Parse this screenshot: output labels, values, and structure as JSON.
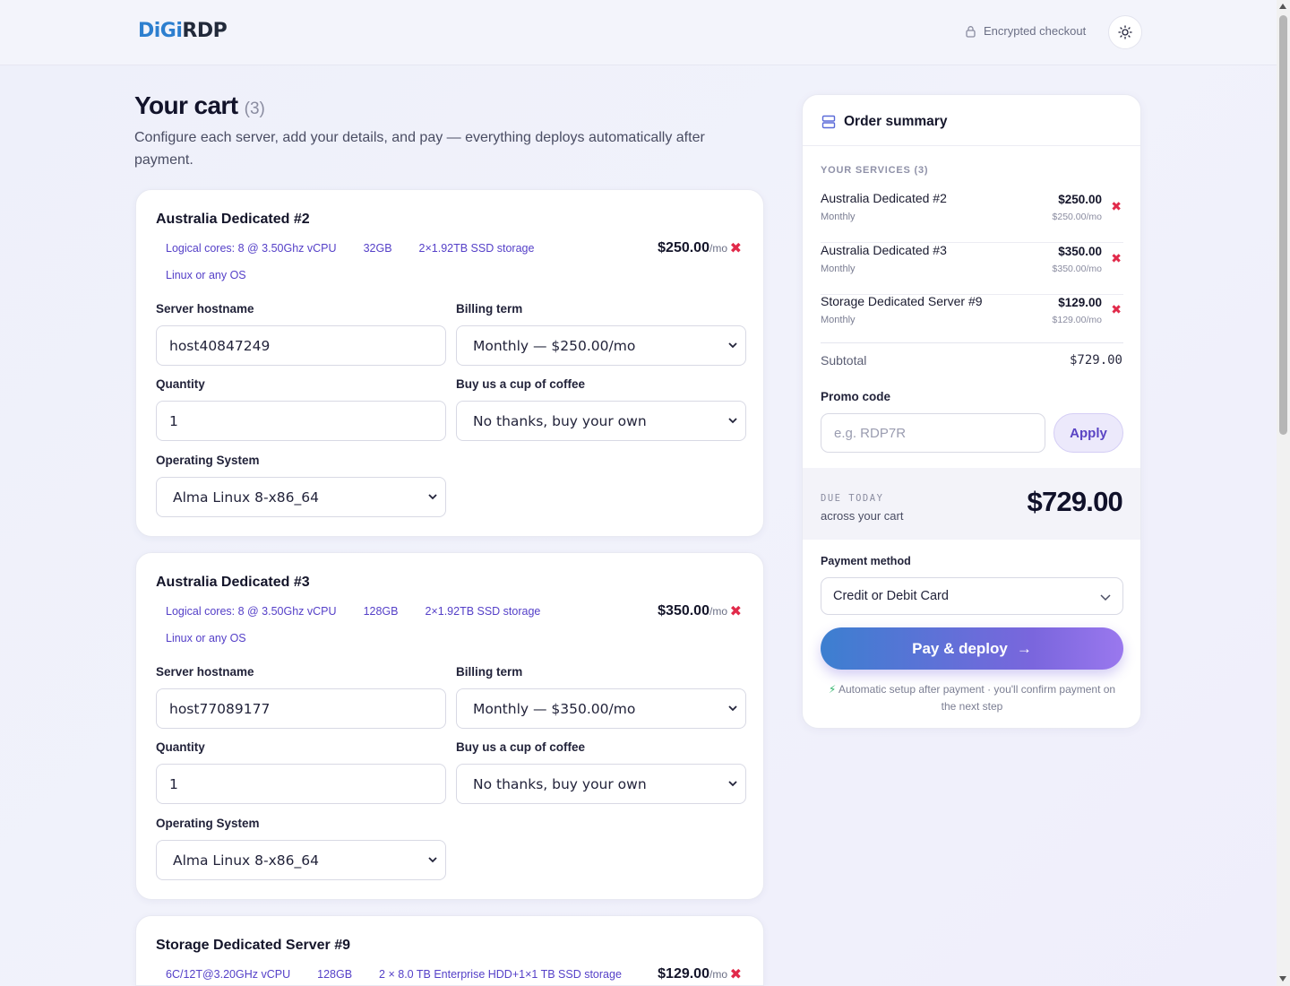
{
  "header": {
    "logo_part1": "DiGi",
    "logo_part2": "RDP",
    "encrypted_label": "Encrypted checkout",
    "theme_icon": "sun-icon"
  },
  "page": {
    "title": "Your cart",
    "count": "(3)",
    "subtitle": "Configure each server, add your details, and pay — everything deploys automatically after payment."
  },
  "labels": {
    "hostname": "Server hostname",
    "billing": "Billing term",
    "quantity": "Quantity",
    "coffee": "Buy us a cup of coffee",
    "os": "Operating System",
    "per_month": "/mo"
  },
  "cart_items": [
    {
      "title": "Australia Dedicated #2",
      "specs": [
        "Logical cores: 8 @ 3.50Ghz vCPU",
        "32GB",
        "2×1.92TB SSD storage",
        "Linux or any OS"
      ],
      "price": "$250.00",
      "hostname": "host40847249",
      "billing": "Monthly — $250.00/mo",
      "quantity": "1",
      "coffee": "No thanks, buy your own",
      "os": "Alma Linux 8-x86_64"
    },
    {
      "title": "Australia Dedicated #3",
      "specs": [
        "Logical cores: 8 @ 3.50Ghz vCPU",
        "128GB",
        "2×1.92TB SSD storage",
        "Linux or any OS"
      ],
      "price": "$350.00",
      "hostname": "host77089177",
      "billing": "Monthly — $350.00/mo",
      "quantity": "1",
      "coffee": "No thanks, buy your own",
      "os": "Alma Linux 8-x86_64"
    },
    {
      "title": "Storage Dedicated Server #9",
      "specs": [
        "6C/12T@3.20GHz vCPU",
        "128GB",
        "2 × 8.0 TB Enterprise HDD+1×1 TB SSD storage"
      ],
      "price": "$129.00"
    }
  ],
  "summary": {
    "title": "Order summary",
    "services_caption": "YOUR SERVICES (3)",
    "services": [
      {
        "name": "Australia Dedicated #2",
        "period": "Monthly",
        "amount": "$250.00",
        "per": "$250.00/mo"
      },
      {
        "name": "Australia Dedicated #3",
        "period": "Monthly",
        "amount": "$350.00",
        "per": "$350.00/mo"
      },
      {
        "name": "Storage Dedicated Server #9",
        "period": "Monthly",
        "amount": "$129.00",
        "per": "$129.00/mo"
      }
    ],
    "subtotal_label": "Subtotal",
    "subtotal_value": "$729.00",
    "promo_label": "Promo code",
    "promo_placeholder": "e.g. RDP7R",
    "apply_label": "Apply",
    "due_caption": "DUE TODAY",
    "due_sub": "across your cart",
    "due_total": "$729.00",
    "payment_label": "Payment method",
    "payment_value": "Credit or Debit Card",
    "pay_label": "Pay & deploy",
    "note_part1": "Automatic setup after payment",
    "note_sep": "·",
    "note_part2": "you'll confirm payment on the next step"
  }
}
